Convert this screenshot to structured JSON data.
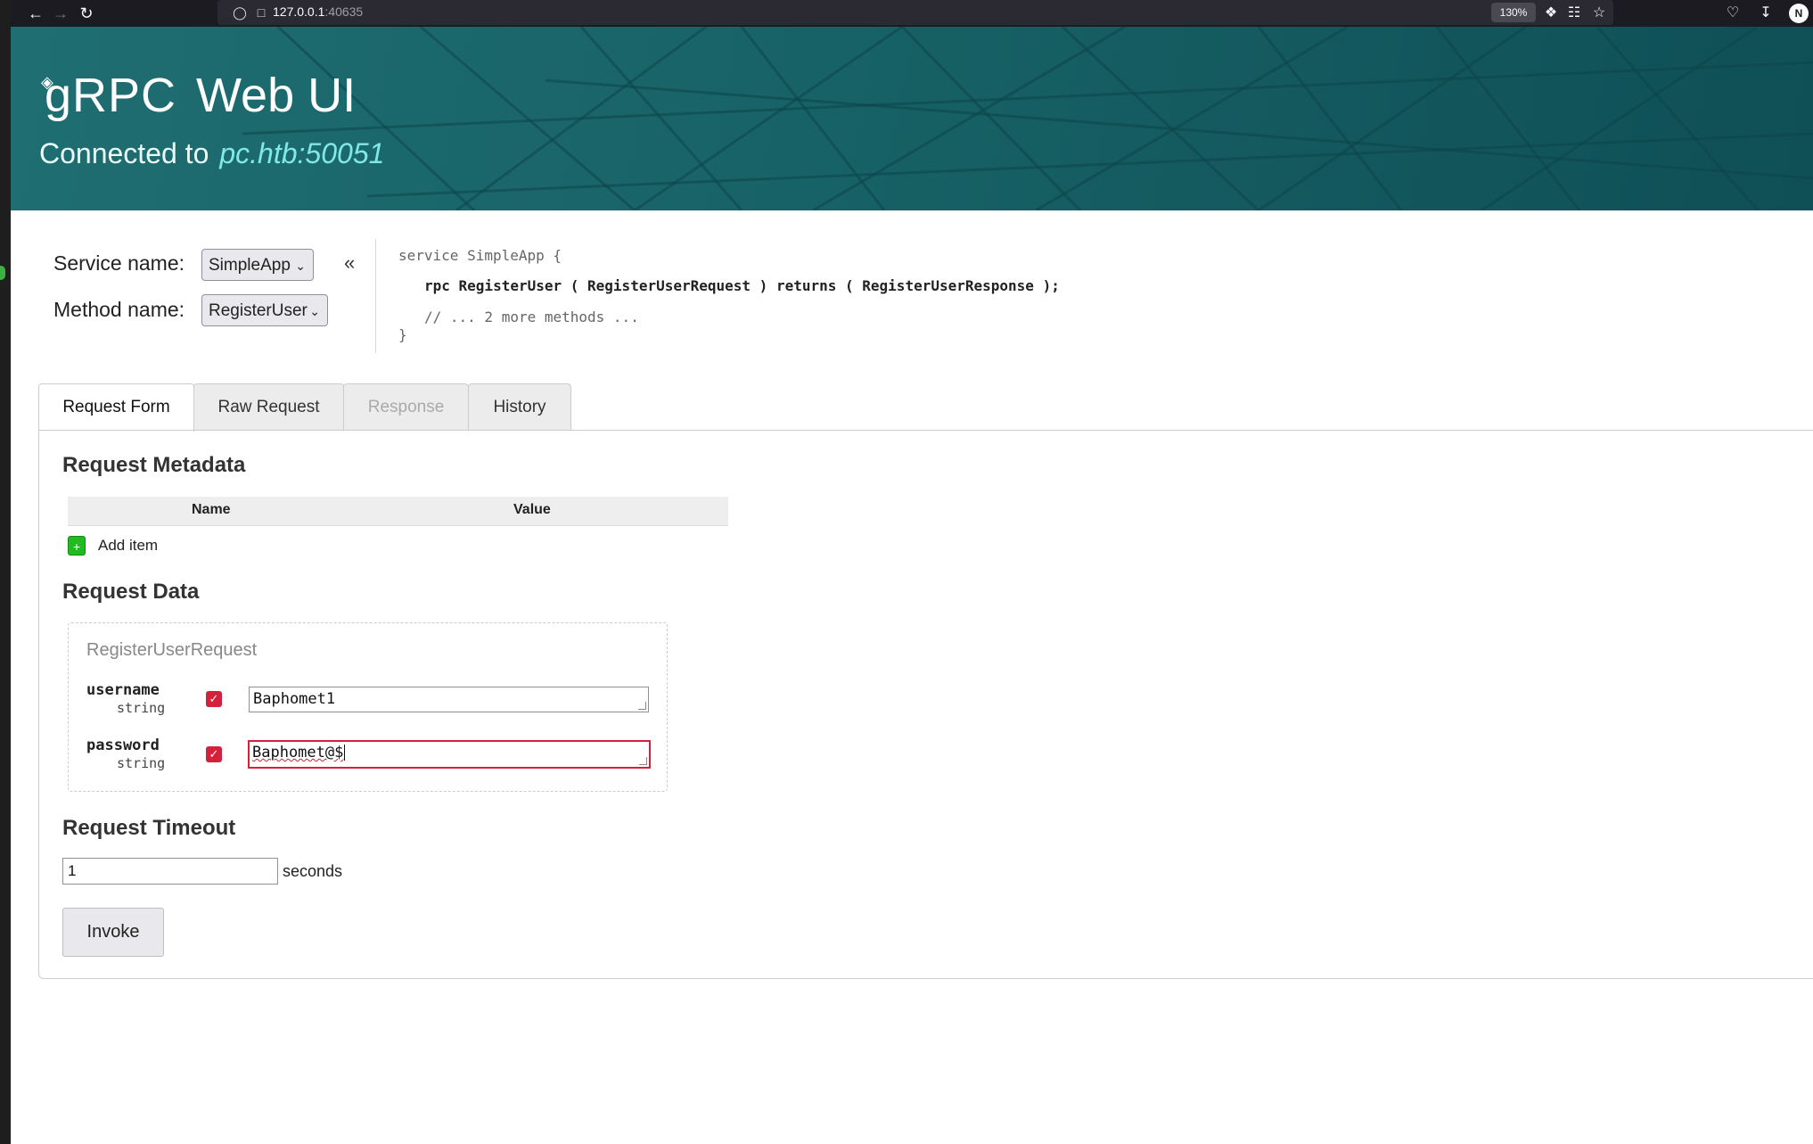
{
  "browser": {
    "url_host": "127.0.0.1",
    "url_port": ":40635",
    "zoom": "130%",
    "profile_initial": "N"
  },
  "header": {
    "logo_text": "gRPC",
    "title_rest": "Web UI",
    "connected_label": "Connected to",
    "connected_address": "pc.htb:50051"
  },
  "selectors": {
    "service_label": "Service name:",
    "service_value": "SimpleApp",
    "method_label": "Method name:",
    "method_value": "RegisterUser",
    "collapse_icon": "«"
  },
  "service_def": {
    "line1": "service SimpleApp {",
    "line2": "rpc RegisterUser ( RegisterUserRequest ) returns ( RegisterUserResponse );",
    "line3": "// ... 2 more methods ...",
    "line4": "}"
  },
  "tabs": [
    {
      "label": "Request Form",
      "state": "active"
    },
    {
      "label": "Raw Request",
      "state": "normal"
    },
    {
      "label": "Response",
      "state": "disabled"
    },
    {
      "label": "History",
      "state": "normal"
    }
  ],
  "metadata": {
    "title": "Request Metadata",
    "col_name": "Name",
    "col_value": "Value",
    "add_label": "Add item",
    "add_icon": "+"
  },
  "request_data": {
    "title": "Request Data",
    "message_type": "RegisterUserRequest",
    "fields": [
      {
        "name": "username",
        "type": "string",
        "value": "Baphomet1",
        "checked": true
      },
      {
        "name": "password",
        "type": "string",
        "value": "Baphomet@$",
        "checked": true
      }
    ]
  },
  "timeout": {
    "title": "Request Timeout",
    "value": "1",
    "unit": "seconds"
  },
  "invoke_label": "Invoke",
  "colors": {
    "banner": "#176266",
    "accent_red": "#d3213b",
    "add_green": "#1fbb1f"
  }
}
